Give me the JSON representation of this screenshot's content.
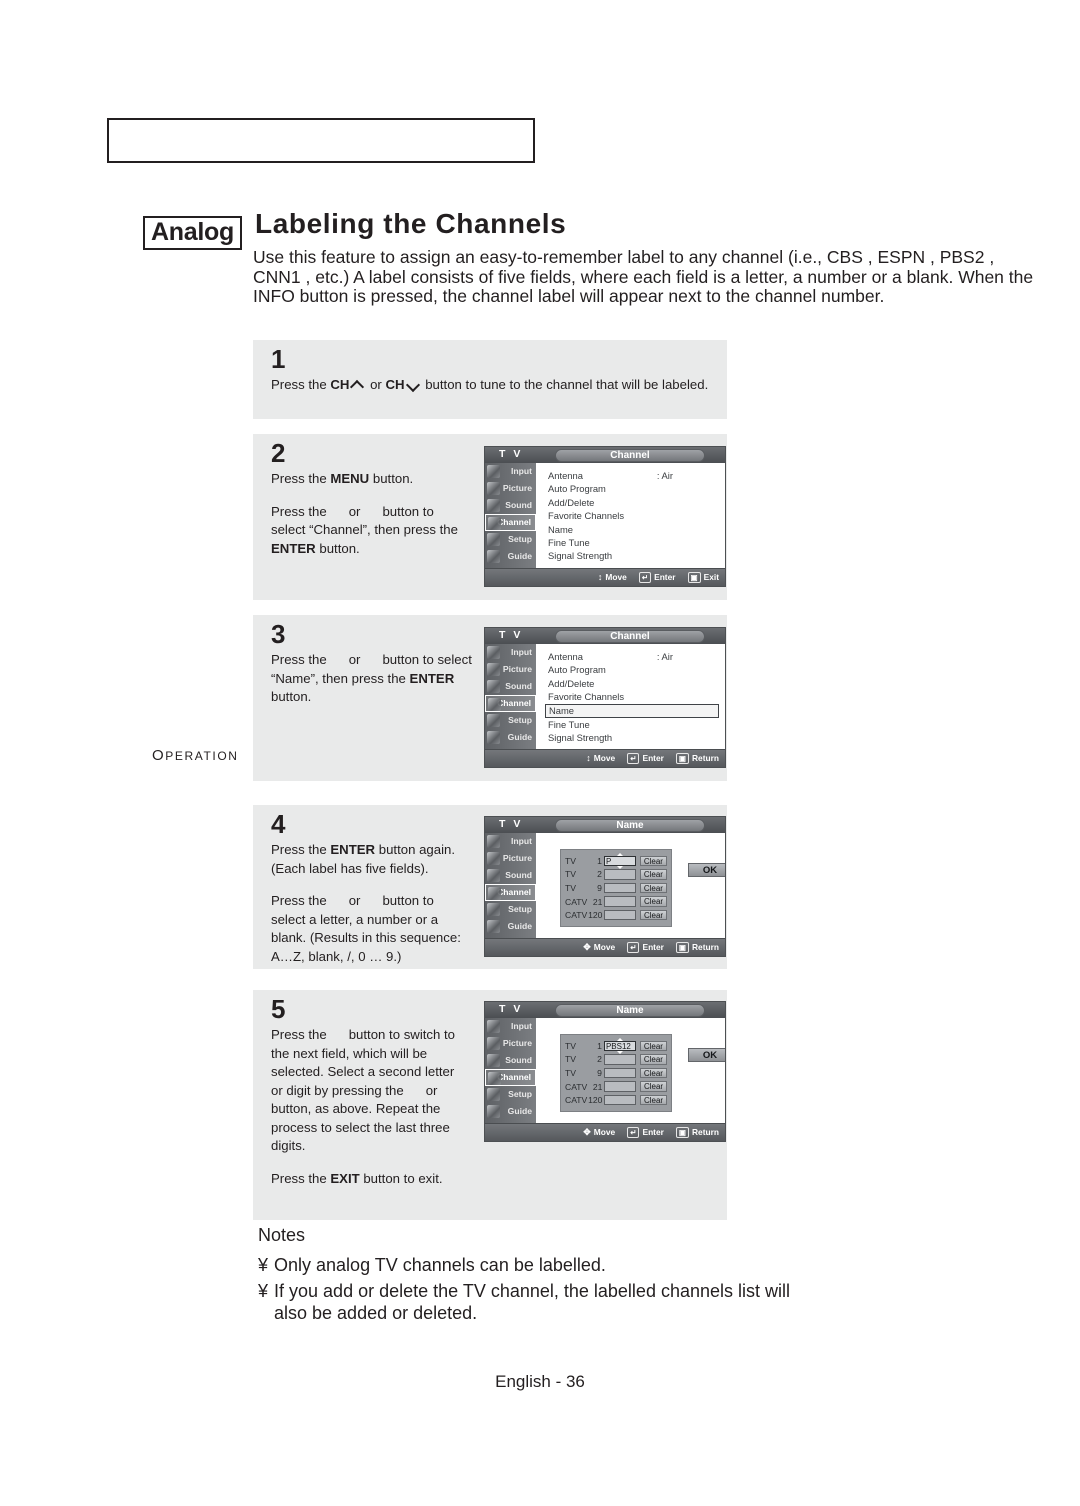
{
  "header": {
    "section_label": "Operation"
  },
  "title": {
    "badge": "Analog",
    "heading": "Labeling the Channels"
  },
  "intro": "Use this feature to assign an easy-to-remember label to any channel (i.e., CBS , ESPN , PBS2 , CNN1 , etc.) A label consists of five fields, where each field is a letter, a number or a blank. When the INFO button is pressed, the channel label will appear next to the channel number.",
  "steps": [
    {
      "number": "1",
      "text_a_pre": "Press the ",
      "text_a_b1": "CH",
      "text_a_mid": " or ",
      "text_a_b2": "CH",
      "text_a_post": " button to tune to the channel that will be labeled."
    },
    {
      "number": "2",
      "p1_pre": "Press the ",
      "p1_b": "MENU",
      "p1_post": " button.",
      "p2_pre": "Press the",
      "p2_mid": "or",
      "p2_post": "button to select “Channel”, then press the ",
      "p2_b": "ENTER",
      "p2_end": " button."
    },
    {
      "number": "3",
      "p1_pre": "Press the",
      "p1_mid": "or",
      "p1_post": "button to select “Name”, then press the ",
      "p1_b": "ENTER",
      "p1_end": " button."
    },
    {
      "number": "4",
      "p1_pre": "Press the ",
      "p1_b": "ENTER",
      "p1_post": " button again. (Each label has five fields).",
      "p2_pre": "Press the",
      "p2_mid": "or",
      "p2_post": "button to select a letter, a number or a blank. (Results in this sequence: A…Z, blank, /, 0 … 9.)"
    },
    {
      "number": "5",
      "p1_pre": "Press the",
      "p1_post": "button to switch to the next field, which will be selected. Select a second letter or digit by pressing the",
      "p1_mid": "or",
      "p1_end": "button, as above. Repeat the process to select the last three digits.",
      "p2_pre": "Press the ",
      "p2_b": "EXIT",
      "p2_post": " button to exit."
    }
  ],
  "osd": {
    "brand": "T V",
    "sidebar": [
      {
        "label": "Input",
        "icon": "camera-input-icon"
      },
      {
        "label": "Picture",
        "icon": "picture-icon"
      },
      {
        "label": "Sound",
        "icon": "speaker-icon"
      },
      {
        "label": "Channel",
        "icon": "satellite-icon"
      },
      {
        "label": "Setup",
        "icon": "tools-icon"
      },
      {
        "label": "Guide",
        "icon": "program-guide-icon"
      }
    ],
    "channel_menu": {
      "title": "Channel",
      "items": [
        {
          "label": "Antenna",
          "value": ": Air"
        },
        {
          "label": "Auto Program",
          "value": ""
        },
        {
          "label": "Add/Delete",
          "value": ""
        },
        {
          "label": "Favorite Channels",
          "value": ""
        },
        {
          "label": "Name",
          "value": ""
        },
        {
          "label": "Fine Tune",
          "value": ""
        },
        {
          "label": "Signal Strength",
          "value": ""
        }
      ]
    },
    "name_menu": {
      "title": "Name",
      "rows": [
        {
          "type": "TV",
          "num": "1",
          "value": ""
        },
        {
          "type": "TV",
          "num": "2",
          "value": ""
        },
        {
          "type": "TV",
          "num": "9",
          "value": ""
        },
        {
          "type": "CATV",
          "num": "21",
          "value": ""
        },
        {
          "type": "CATV",
          "num": "120",
          "value": ""
        }
      ],
      "clear_label": "Clear",
      "ok_label": "OK",
      "value_step4": "P",
      "value_step5": "PBS12"
    },
    "footer_exit": [
      {
        "label": "Move",
        "icon": "up-down-arrows-icon"
      },
      {
        "label": "Enter",
        "icon": "enter-key-icon"
      },
      {
        "label": "Exit",
        "icon": "menu-key-icon"
      }
    ],
    "footer_return": [
      {
        "label": "Move",
        "icon": "up-down-arrows-icon"
      },
      {
        "label": "Enter",
        "icon": "enter-key-icon"
      },
      {
        "label": "Return",
        "icon": "menu-key-icon"
      }
    ],
    "footer_return4way": [
      {
        "label": "Move",
        "icon": "four-way-arrows-icon"
      },
      {
        "label": "Enter",
        "icon": "enter-key-icon"
      },
      {
        "label": "Return",
        "icon": "menu-key-icon"
      }
    ]
  },
  "notes": {
    "title": "Notes",
    "bullet": "¥",
    "items": [
      "Only analog TV channels can be labelled.",
      "If you add or delete the TV channel, the labelled channels list will",
      "also be added or deleted."
    ]
  },
  "footer": {
    "page": "English - 36"
  }
}
